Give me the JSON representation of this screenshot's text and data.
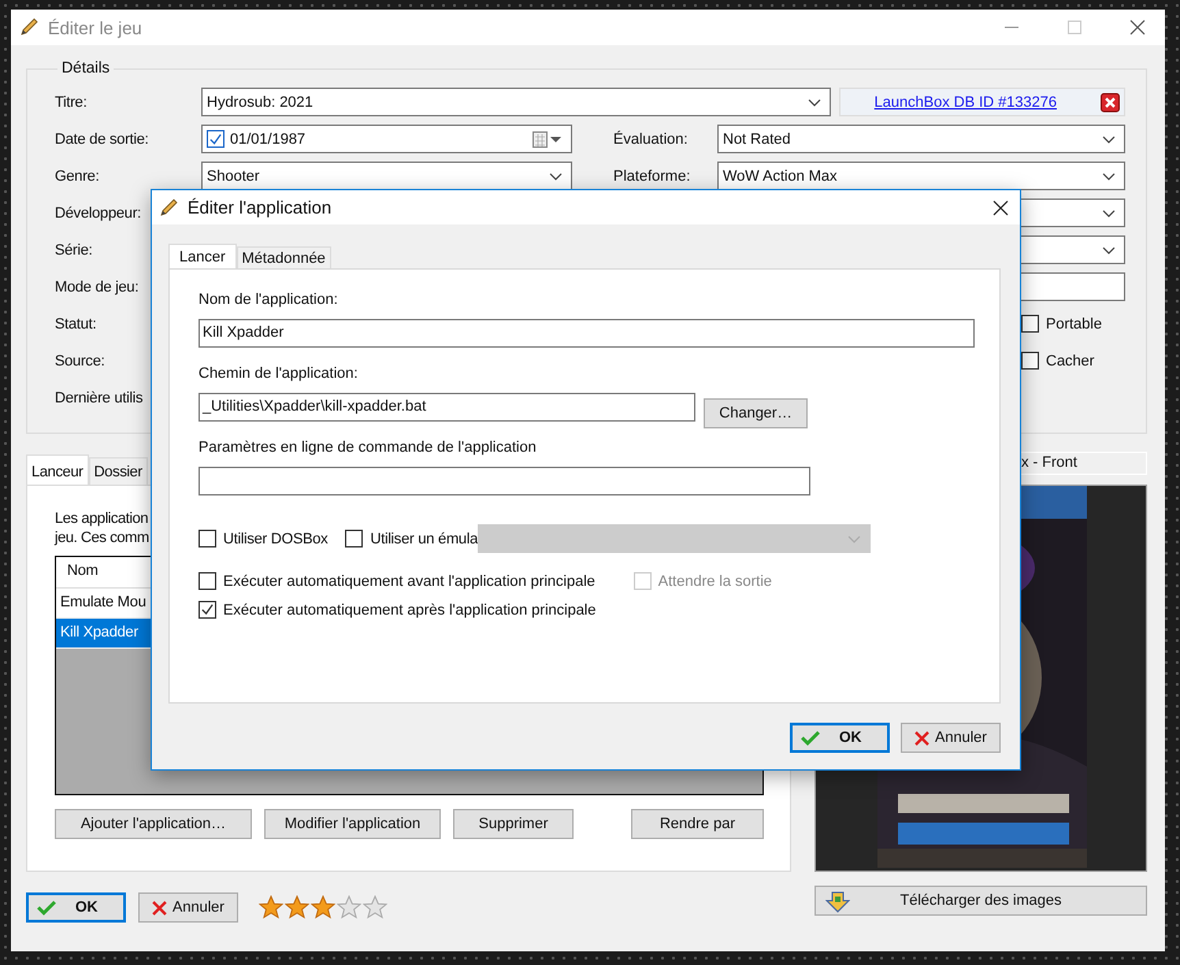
{
  "main_window": {
    "title": "Éditer le jeu",
    "details": {
      "legend": "Détails",
      "rows": [
        {
          "label": "Titre:",
          "field": {
            "kind": "combo",
            "value": "Hydrosub: 2021"
          },
          "link": "LaunchBox DB ID #133276"
        },
        {
          "label": "Date de sortie:",
          "field": {
            "kind": "date",
            "value": "01/01/1987",
            "checked": true
          },
          "right": {
            "label": "Évaluation:",
            "field": {
              "kind": "combo",
              "value": "Not Rated"
            }
          }
        },
        {
          "label": "Genre:",
          "field": {
            "kind": "combo",
            "value": "Shooter"
          },
          "right": {
            "label": "Plateforme:",
            "field": {
              "kind": "combo",
              "value": "WoW Action Max"
            }
          }
        },
        {
          "label": "Développeur:",
          "right": {
            "field": {
              "kind": "combo"
            }
          }
        },
        {
          "label": "Série:",
          "right": {
            "field": {
              "kind": "combo"
            }
          }
        },
        {
          "label": "Mode de jeu:",
          "right": {
            "field": {
              "kind": "text"
            }
          }
        },
        {
          "label": "Statut:",
          "right": {
            "field": {
              "kind": "checkbox",
              "label": "Portable",
              "checked": false
            }
          }
        },
        {
          "label": "Source:",
          "right": {
            "field": {
              "kind": "checkbox",
              "label": "Cacher",
              "checked": false
            }
          }
        },
        {
          "label": "Dernière utilis"
        }
      ]
    },
    "tabs": [
      {
        "label": "Lanceur",
        "selected": true
      },
      {
        "label": "Dossier",
        "selected": false
      }
    ],
    "description": [
      "Les application",
      "jeu. Ces comm"
    ],
    "app_list": {
      "columns": [
        "Nom"
      ],
      "rows": [
        {
          "name": "Emulate Mou",
          "selected": false
        },
        {
          "name": "Kill Xpadder",
          "selected": true
        }
      ]
    },
    "app_buttons": [
      "Ajouter l'application…",
      "Modifier l'application",
      "Supprimer",
      "Rendre par"
    ],
    "image_panel": {
      "header": "x - Front",
      "download_button": "Télécharger des images"
    },
    "buttons": [
      {
        "label": "OK",
        "kind": "ok"
      },
      {
        "label": "Annuler",
        "kind": "cancel"
      }
    ],
    "rating": {
      "stars": 3
    }
  },
  "dialog": {
    "title": "Éditer l'application",
    "tabs": [
      {
        "label": "Lancer",
        "selected": true
      },
      {
        "label": "Métadonnée",
        "selected": false
      }
    ],
    "name_label": "Nom de l'application:",
    "name_value": "Kill Xpadder",
    "path_label": "Chemin de l'application:",
    "path_value": "_Utilities\\Xpadder\\kill-xpadder.bat",
    "change_button": "Changer…",
    "params_label": "Paramètres en ligne de commande de l'application",
    "options": [
      {
        "label": "Utiliser DOSBox",
        "checked": false
      },
      {
        "label": "Utiliser un émula",
        "checked": false
      }
    ],
    "emulator_combo": {
      "disabled": true
    },
    "auto_run": [
      {
        "label": "Exécuter automatiquement avant l'application principale",
        "checked": false
      },
      {
        "label": "Exécuter automatiquement après l'application principale",
        "checked": true
      }
    ],
    "wait_exit": {
      "label": "Attendre la sortie",
      "checked": false,
      "disabled": true
    },
    "buttons": [
      {
        "label": "OK",
        "kind": "ok"
      },
      {
        "label": "Annuler",
        "kind": "cancel"
      }
    ]
  }
}
